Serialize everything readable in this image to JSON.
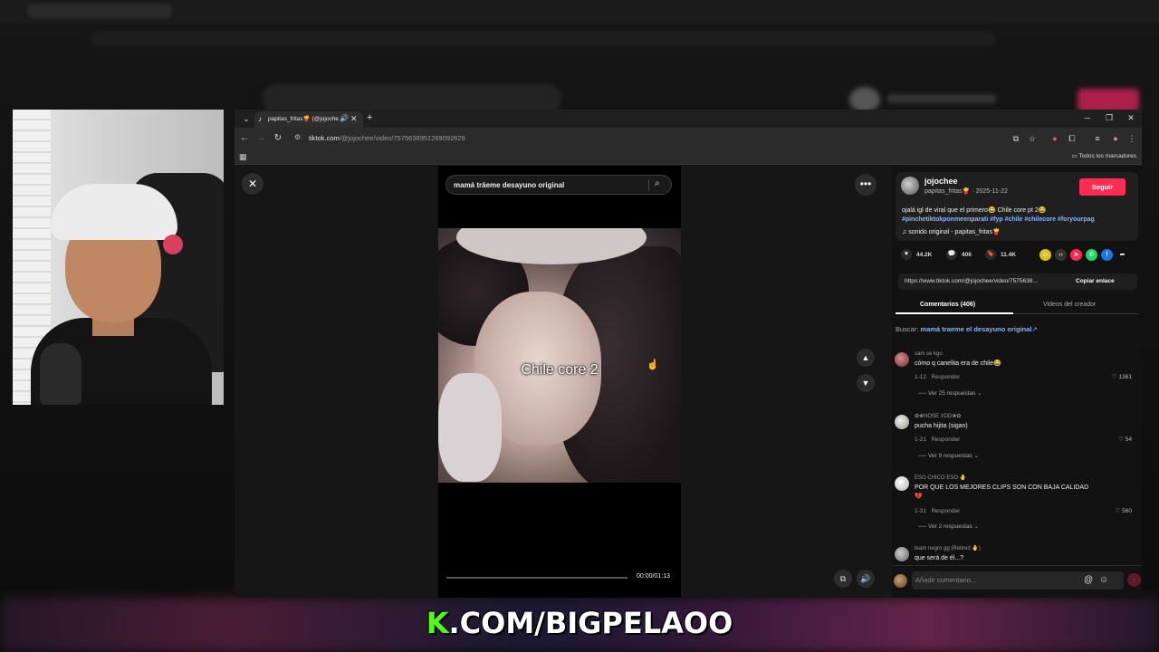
{
  "browser": {
    "tab_title": "papitas_fritas🍟 (@jojoche",
    "url_host": "tiktok.com",
    "url_path": "/@jojochee/video/7575638951269092629",
    "bookmarks_label": "Todos los marcadores"
  },
  "tiktok": {
    "search_query": "mamá tráeme desayuno original",
    "video_caption": "Chile core 2",
    "progress_fraction": 0.0,
    "time": "00:00/01:13",
    "author": {
      "handle": "jojochee",
      "sub": "papitas_fritas🍟 · 2025-11-22",
      "follow_label": "Seguir"
    },
    "description": "ojalá igl de viral que el primero😂 Chile core pt 2😂",
    "hashtags": "#pinchetiktokponmeenparati #fyp #chile #chilecore #foryourpag",
    "sound": "♫  sonido original - papitas_fritas🍟",
    "stats": {
      "likes": "44.2K",
      "comments": "406",
      "saves": "11.4K"
    },
    "share_link": "https://www.tiktok.com/@jojochee/video/7575638...",
    "copy_label": "Copiar enlace",
    "tabs": {
      "comments": "Comentarios (406)",
      "creator": "Videos del creador"
    },
    "buscar_label": "Buscar:",
    "buscar_query": "mamá traeme el desayuno original",
    "comments": [
      {
        "user": "sam se kgo",
        "text": "cómo q canelita era de chile😂",
        "date": "1-12",
        "reply": "Responder",
        "likes": "1361",
        "more": "Ver 25 respuestas ⌄"
      },
      {
        "user": "✿❀NOSE XDD❀✿",
        "text": "pucha hijita (sigan)",
        "date": "1-21",
        "reply": "Responder",
        "likes": "54",
        "more": "Ver 9 respuestas ⌄"
      },
      {
        "user": "ESO CHICO ESO 🤚",
        "text": "POR QUE LOS MEJORES CLIPS SON CON BAJA CALIDAD",
        "text2": "💔",
        "date": "1-31",
        "reply": "Responder",
        "likes": "560",
        "more": "Ver 2 respuestas ⌄"
      },
      {
        "user": "team negro gg (Retired 🤚)",
        "text": "que será de él...?"
      }
    ],
    "comment_placeholder": "Añadir comentario..."
  },
  "overlay": {
    "banner_k": "K",
    "banner_rest": ".COM/BIGPELAOO"
  },
  "colors": {
    "follow": "#fe2c55",
    "kick_green": "#53fc18",
    "link_blue": "#8ab4f8"
  }
}
